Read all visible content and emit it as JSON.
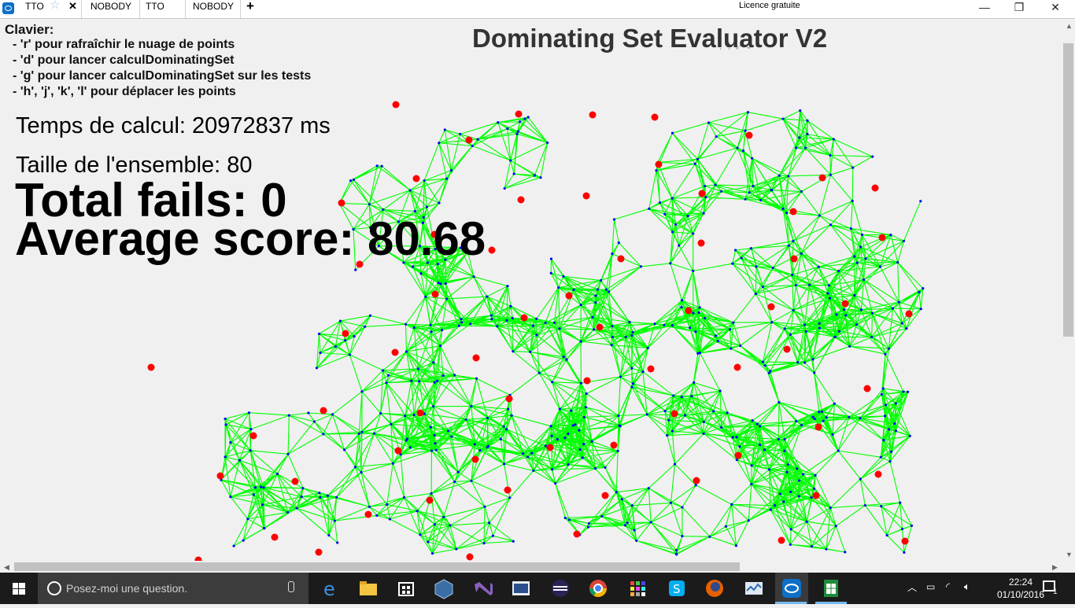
{
  "tabs": [
    {
      "label": "TTO",
      "active": true
    },
    {
      "label": "NOBODY",
      "active": false
    },
    {
      "label": "TTO",
      "active": false
    },
    {
      "label": "NOBODY",
      "active": false
    }
  ],
  "licence": "Licence gratuite",
  "app": {
    "title": "Dominating Set Evaluator V2",
    "keys_title": "Clavier:",
    "key_lines": [
      "- 'r' pour rafraîchir le nuage de points",
      "- 'd' pour lancer calculDominatingSet",
      "- 'g' pour lancer calculDominatingSet sur les tests",
      "- 'h', 'j', 'k', 'l' pour déplacer les points"
    ],
    "calc_time": "Temps de calcul: 20972837 ms",
    "set_size": "Taille de l'ensemble: 80",
    "total_fails": "Total fails: 0",
    "average_score": "Average score: 80.68",
    "colors": {
      "edges": "#00ff00",
      "dominators": "#ff0000",
      "points": "#0000ff"
    }
  },
  "taskbar": {
    "search_placeholder": "Posez-moi une question.",
    "time": "22:24",
    "date": "01/10/2016",
    "notification_count": "1",
    "apps": [
      "edge-icon",
      "file-explorer-icon",
      "store-icon",
      "virtualbox-icon",
      "visual-studio-icon",
      "terminal-icon",
      "eclipse-icon",
      "chrome-icon",
      "grid-app-icon",
      "skype-icon",
      "firefox-icon",
      "task-monitor-icon",
      "teamviewer-icon",
      "spreadsheet-icon"
    ]
  }
}
